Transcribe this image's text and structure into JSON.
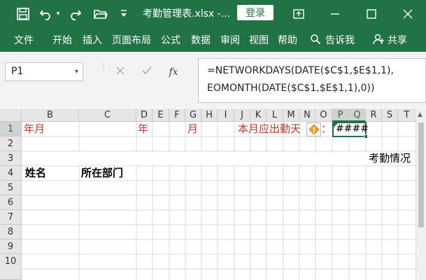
{
  "titlebar": {
    "title": "考勤管理表.xlsx -...",
    "login": "登录"
  },
  "ribbon": {
    "tabs": [
      "文件",
      "开始",
      "插入",
      "页面布局",
      "公式",
      "数据",
      "审阅",
      "视图",
      "帮助"
    ],
    "tell_me": "告诉我",
    "share": "共享"
  },
  "formula_bar": {
    "name_box": "P1",
    "fx": "fx",
    "formula_line1": "=NETWORKDAYS(DATE($C$1,$E$1,1),",
    "formula_line2": "EOMONTH(DATE($C$1,$E$1,1),0))"
  },
  "sheet": {
    "columns": [
      "B",
      "C",
      "D",
      "E",
      "F",
      "G",
      "H",
      "I",
      "J",
      "K",
      "L",
      "M",
      "N",
      "O",
      "P",
      "Q",
      "R",
      "S",
      "T"
    ],
    "rows": [
      "1",
      "2",
      "3",
      "4",
      "5",
      "6",
      "7",
      "8",
      "9",
      "10"
    ],
    "cells": {
      "b1": "年月",
      "d1": "年",
      "g1": "月",
      "k1": "本月应出勤天",
      "colon": "：",
      "p1": "####",
      "s3": "考勤情况",
      "b4": "姓名",
      "c4": "所在部门"
    },
    "selected_cell": "P1",
    "warning_icon": "warning-diamond-icon",
    "accent_color": "#217346",
    "label_color": "#c0392b"
  }
}
